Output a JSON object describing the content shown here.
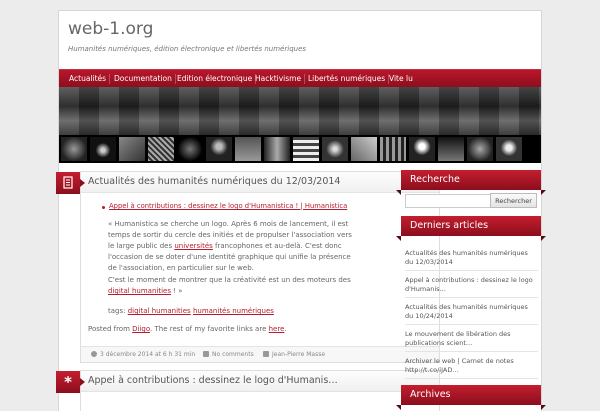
{
  "site": {
    "title": "web-1.org",
    "description": "Humanités numériques, édition électronique et libertés numériques"
  },
  "nav": {
    "items": [
      "Actualités",
      "Documentation",
      "Edition électronique",
      "Hacktivisme",
      "Libertés numériques",
      "Vite lu"
    ]
  },
  "post1": {
    "title": "Actualités des humanités numériques du 12/03/2014",
    "bullet_link": "Appel à contributions : dessinez le logo d'Humanistica ! | Humanistica",
    "para1_a": "« Humanistica se cherche un logo. Après 6 mois de lancement, il est temps de sortir du cercle des initiés et de propulser l'association vers le large public des ",
    "para1_link": "universités",
    "para1_b": " francophones et au-delà. C'est donc l'occasion de se doter d'une identité graphique qui unifie la présence de l'association, en particulier sur le web.",
    "para2_a": "C'est le moment de montrer que la créativité est un des moteurs des ",
    "para2_link": "digital humanities",
    "para2_b": " ! »",
    "tags_label": "tags: ",
    "tag1": "digital humanities",
    "tag2": "humanités numériques",
    "posted_a": "Posted from ",
    "posted_link1": "Diigo",
    "posted_b": ". The rest of my favorite links are ",
    "posted_link2": "here",
    "posted_c": ".",
    "date": "3 décembre 2014 at 6 h 31 min",
    "comments": "No comments",
    "author": "Jean-Pierre Masse"
  },
  "post2": {
    "title": "Appel à contributions : dessinez le logo d'Humanis…"
  },
  "sidebar": {
    "search_title": "Recherche",
    "search_button": "Rechercher",
    "search_value": "",
    "recent_title": "Derniers articles",
    "recent_items": [
      "Actualités des humanités numériques du 12/03/2014",
      "Appel à contributions : dessinez le logo d'Humanis…",
      "Actualités des humanités numériques du 10/24/2014",
      "Le mouvement de libération des publications scient…",
      "Archiver le web | Carnet de notes http://t.co/iJAD…"
    ],
    "archives_title": "Archives"
  },
  "colors": {
    "accent": "#b71c2c",
    "nav_dark": "#8b0e1d"
  },
  "icons": {
    "post1": "document-icon",
    "post2": "asterisk-icon"
  }
}
